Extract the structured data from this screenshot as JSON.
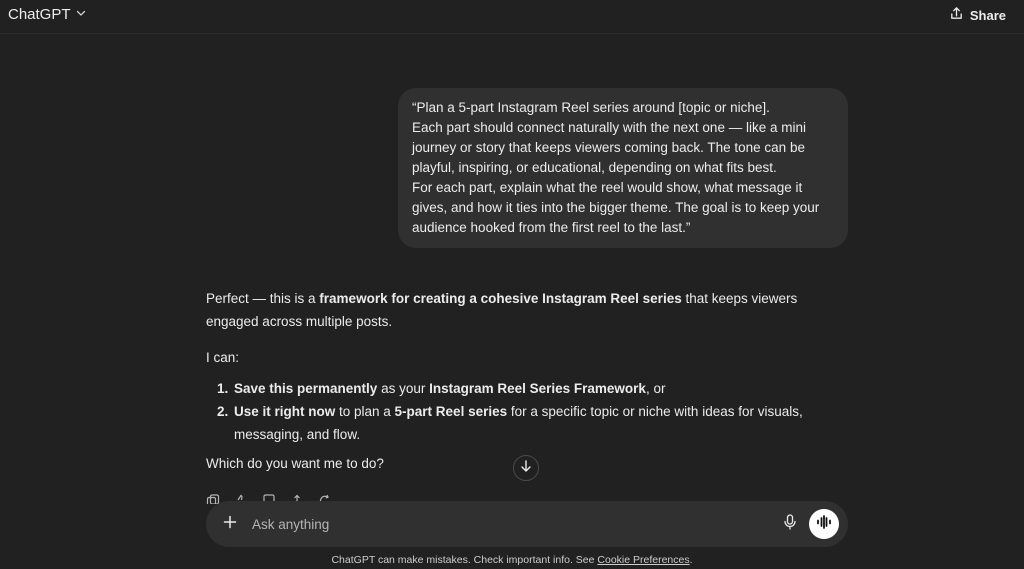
{
  "header": {
    "model_name": "ChatGPT",
    "share_label": "Share"
  },
  "user_message": {
    "lines": [
      "“Plan a 5-part Instagram Reel series around [topic or niche].",
      "Each part should connect naturally with the next one — like a mini journey or story that keeps viewers coming back. The tone can be playful, inspiring, or educational, depending on what fits best.",
      "For each part, explain what the reel would show, what message it gives, and how it ties into the bigger theme. The goal is to keep your audience hooked from the first reel to the last.”"
    ]
  },
  "assistant_message": {
    "intro_pre": "Perfect — this is a ",
    "intro_bold": "framework for creating a cohesive Instagram Reel series",
    "intro_post": " that keeps viewers engaged across multiple posts.",
    "i_can": "I can:",
    "options": [
      {
        "bold1": "Save this permanently",
        "text1": " as your ",
        "bold2": "Instagram Reel Series Framework",
        "text2": ", or"
      },
      {
        "bold1": "Use it right now",
        "text1": " to plan a ",
        "bold2": "5-part Reel series",
        "text2": " for a specific topic or niche with ideas for visuals, messaging, and flow."
      }
    ],
    "question": "Which do you want me to do?"
  },
  "composer": {
    "placeholder": "Ask anything"
  },
  "footer": {
    "disclaimer": "ChatGPT can make mistakes. Check important info. See ",
    "link": "Cookie Preferences",
    "end": "."
  },
  "icons": {
    "model_chevron": "chevron-down-icon",
    "share": "share-icon",
    "plus": "plus-icon",
    "mic": "microphone-icon",
    "voice": "voice-mode-icon",
    "scroll": "arrow-down-icon"
  }
}
